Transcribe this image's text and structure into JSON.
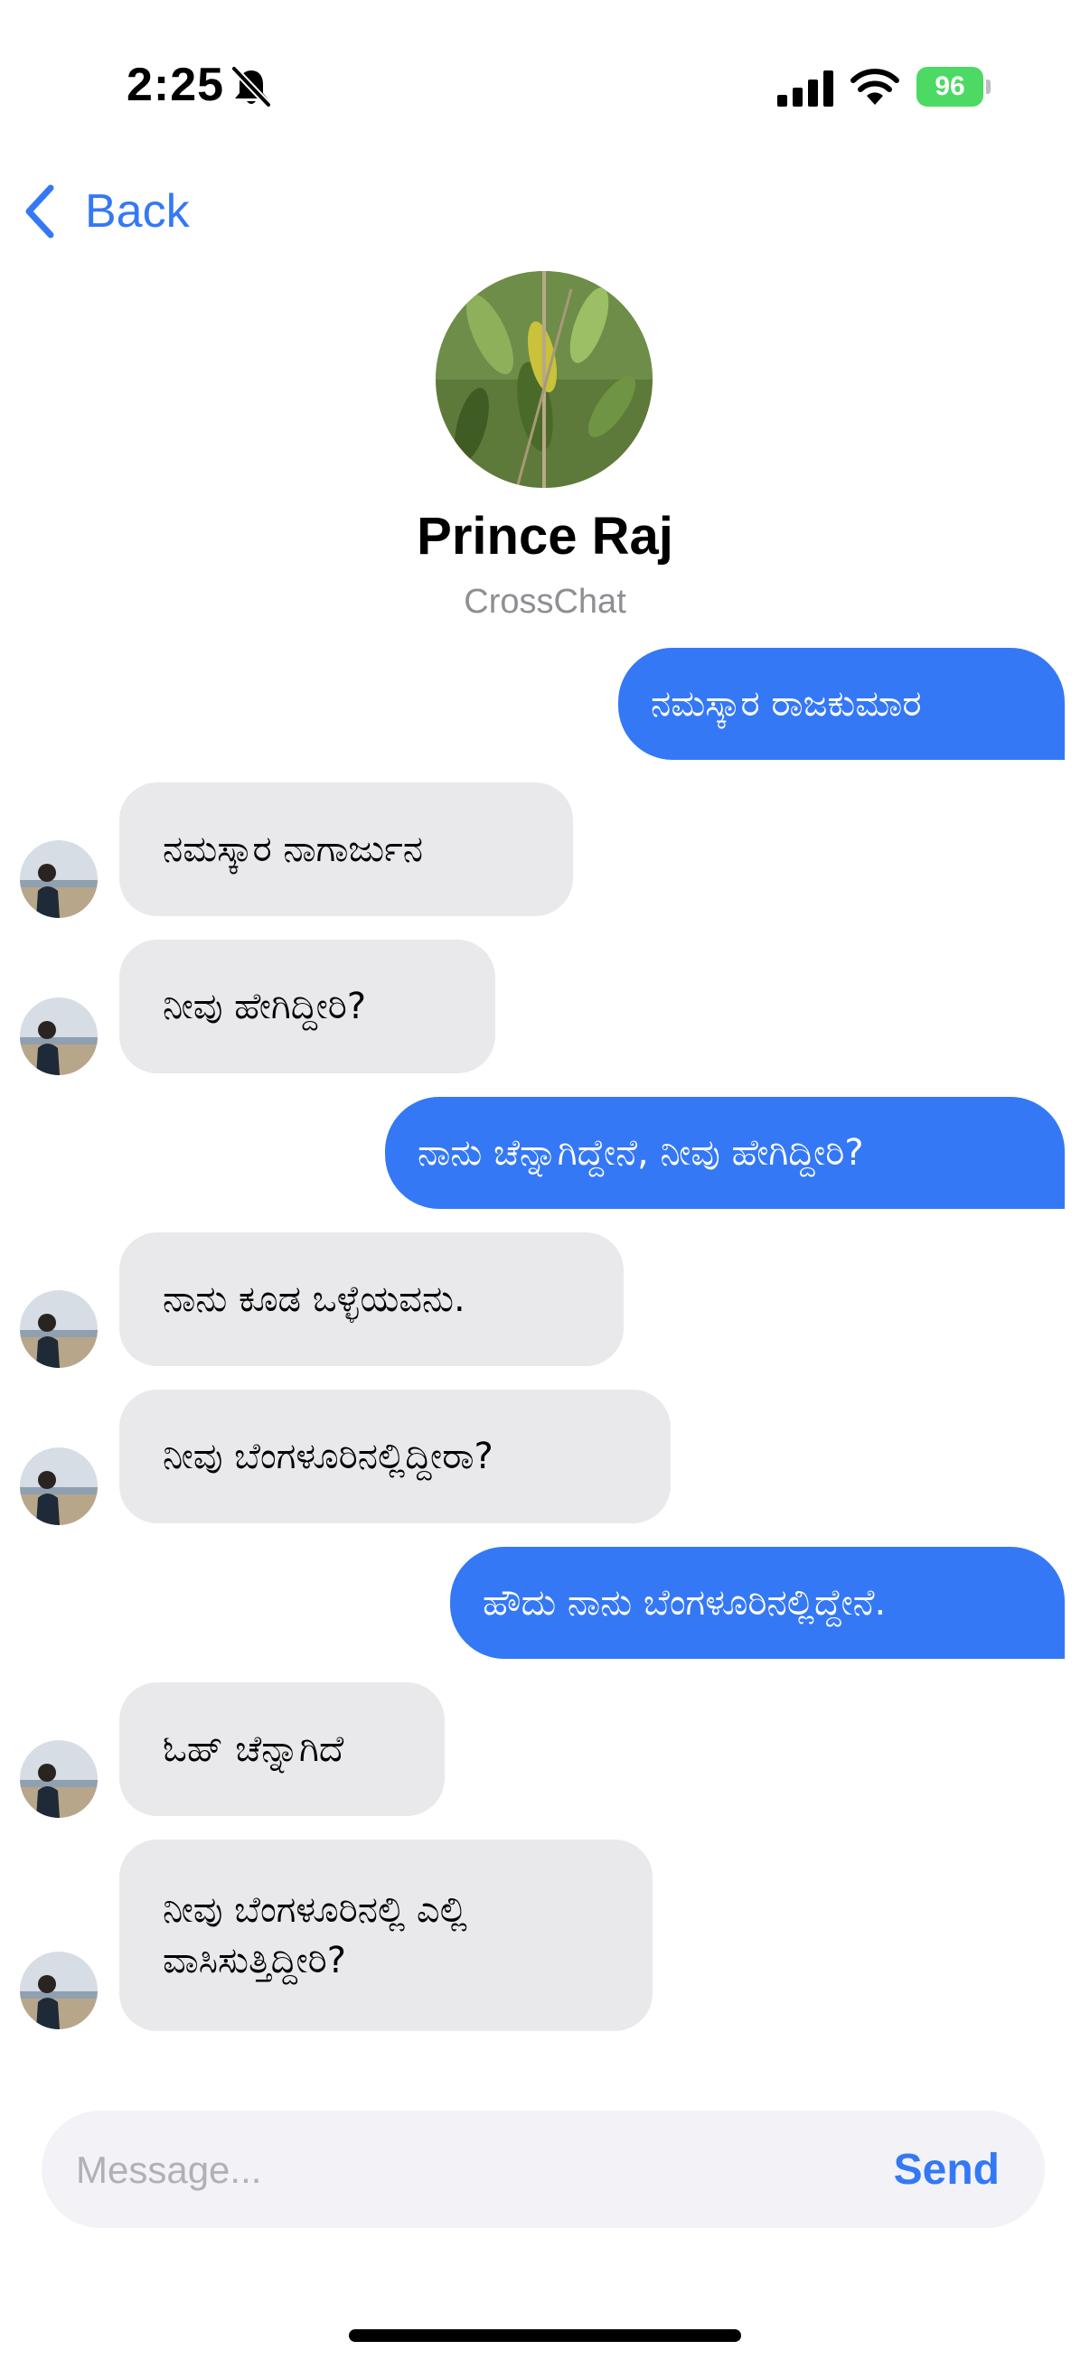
{
  "status_bar": {
    "time": "2:25",
    "battery_level": "96",
    "icons": [
      "bell-slash-icon",
      "cellular-signal-icon",
      "wifi-icon",
      "battery-charging-icon"
    ]
  },
  "nav": {
    "back_label": "Back",
    "back_icon": "chevron-left-icon"
  },
  "contact": {
    "name": "Prince Raj",
    "app": "CrossChat"
  },
  "messages": [
    {
      "direction": "outgoing",
      "text": "ನಮಸ್ಕಾರ ರಾಜಕುಮಾರ"
    },
    {
      "direction": "incoming",
      "text": "ನಮಸ್ಕಾರ ನಾಗಾರ್ಜುನ"
    },
    {
      "direction": "incoming",
      "text": "ನೀವು ಹೇಗಿದ್ದೀರಿ?"
    },
    {
      "direction": "outgoing",
      "text": "ನಾನು ಚೆನ್ನಾಗಿದ್ದೇನೆ, ನೀವು ಹೇಗಿದ್ದೀರಿ?"
    },
    {
      "direction": "incoming",
      "text": "ನಾನು ಕೂಡ ಒಳ್ಳೆಯವನು."
    },
    {
      "direction": "incoming",
      "text": "ನೀವು ಬೆಂಗಳೂರಿನಲ್ಲಿದ್ದೀರಾ?"
    },
    {
      "direction": "outgoing",
      "text": "ಹೌದು ನಾನು ಬೆಂಗಳೂರಿನಲ್ಲಿದ್ದೇನೆ."
    },
    {
      "direction": "incoming",
      "text": "ಓಹ್ ಚೆನ್ನಾಗಿದೆ"
    },
    {
      "direction": "incoming",
      "text": "ನೀವು ಬೆಂಗಳೂರಿನಲ್ಲಿ ಎಲ್ಲಿ ವಾಸಿಸುತ್ತಿದ್ದೀರಿ?"
    }
  ],
  "composer": {
    "placeholder": "Message...",
    "value": "",
    "send_label": "Send"
  },
  "colors": {
    "accent": "#3478f6",
    "incoming_bubble": "#e9e9eb",
    "battery_green": "#4cd964",
    "secondary_text": "#8e8e93"
  }
}
